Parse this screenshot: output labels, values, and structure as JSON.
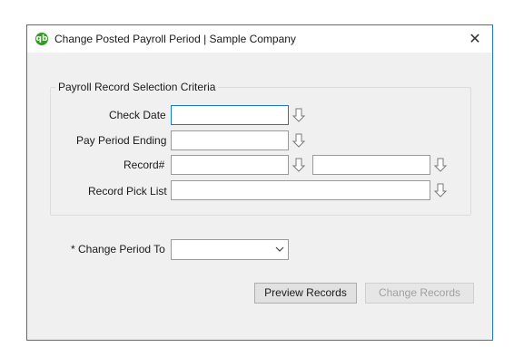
{
  "window": {
    "title": "Change Posted Payroll Period  |  Sample Company",
    "app_icon_text": "qb",
    "close_glyph": "✕",
    "accent_color": "#1c7ad6",
    "app_icon_color": "#2ca01c"
  },
  "criteria": {
    "group_title": "Payroll Record Selection Criteria",
    "check_date": {
      "label": "Check Date",
      "value": "",
      "icon": "down-arrow-icon"
    },
    "pay_period_ending": {
      "label": "Pay Period Ending",
      "value": "",
      "icon": "down-arrow-icon"
    },
    "record_number": {
      "label": "Record#",
      "from_value": "",
      "to_value": "",
      "icon": "down-arrow-icon"
    },
    "record_pick_list": {
      "label": "Record Pick List",
      "value": "",
      "icon": "down-arrow-icon"
    }
  },
  "change_period": {
    "label": "* Change Period To",
    "selected": "",
    "icon": "chevron-down-icon"
  },
  "buttons": {
    "preview": "Preview Records",
    "change": "Change Records"
  }
}
